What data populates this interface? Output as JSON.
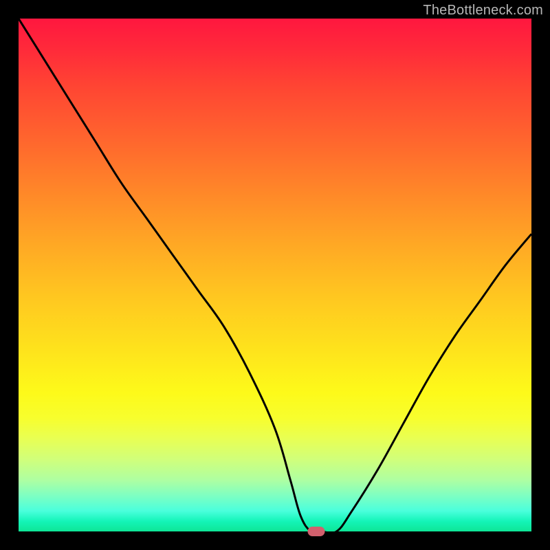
{
  "watermark": "TheBottleneck.com",
  "chart_data": {
    "type": "line",
    "title": "",
    "xlabel": "",
    "ylabel": "",
    "xlim": [
      0,
      100
    ],
    "ylim": [
      0,
      100
    ],
    "grid": false,
    "legend": false,
    "background": "heat-gradient",
    "series": [
      {
        "name": "bottleneck-curve",
        "stroke": "#000000",
        "x": [
          0,
          5,
          10,
          15,
          20,
          25,
          30,
          35,
          40,
          45,
          50,
          53,
          55,
          57,
          59,
          62,
          65,
          70,
          75,
          80,
          85,
          90,
          95,
          100
        ],
        "values": [
          100,
          92,
          84,
          76,
          68,
          61,
          54,
          47,
          40,
          31,
          20,
          10,
          3,
          0,
          0,
          0,
          4,
          12,
          21,
          30,
          38,
          45,
          52,
          58
        ]
      }
    ],
    "marker": {
      "name": "optimal-point",
      "x": 58,
      "y": 0,
      "color": "#d1606d"
    }
  },
  "colors": {
    "gradient_top": "#ff173f",
    "gradient_bottom": "#0ee596",
    "marker": "#d1606d",
    "curve": "#000000",
    "frame": "#000000"
  }
}
